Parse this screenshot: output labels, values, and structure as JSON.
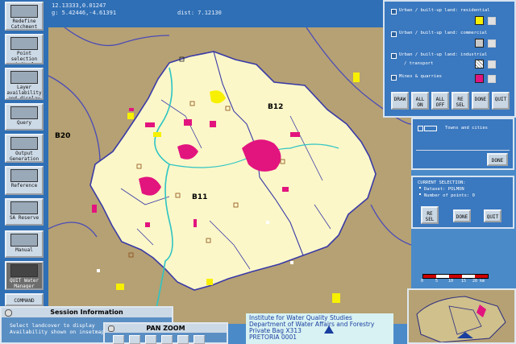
{
  "coordinates": {
    "line1": "12.13333,0.01247",
    "line2": "g: 5.42446,-4.61391",
    "distance": "dist: 7.12130"
  },
  "toolbar": {
    "items": [
      {
        "label": "Redefine Catchment"
      },
      {
        "label": "Point selection and display"
      },
      {
        "label": "Layer availability and display"
      },
      {
        "label": "Query"
      },
      {
        "label": "Output Generation"
      },
      {
        "label": "Reference"
      },
      {
        "label": "SA Reserve"
      },
      {
        "label": "Manual"
      },
      {
        "label": "QUIT Water Manager"
      },
      {
        "label": "COMMAND"
      }
    ]
  },
  "map": {
    "regions": {
      "b12": "B12",
      "b20": "B20",
      "b11": "B11"
    }
  },
  "legend": {
    "rows": [
      {
        "label": "Urban / built-up land: residential",
        "color": "#f7f000"
      },
      {
        "label": "Urban / built-up land: commercial",
        "color": "#c8c8c8"
      },
      {
        "label": "Urban / built-up land: industrial",
        "label2": "/ transport",
        "color": "#ffffff"
      },
      {
        "label": "Mines & quarries",
        "color": "#e2147e"
      }
    ],
    "buttons": [
      "DRAW",
      "ALL ON",
      "ALL OFF",
      "RE SEL",
      "DONE",
      "QUIT"
    ]
  },
  "towns": {
    "label": "Towns and cities",
    "done": "DONE"
  },
  "selection": {
    "title": "CURRENT SELECTION:",
    "dataset": "Dataset: POLMON",
    "points": "Number of points: 0",
    "buttons": [
      "RE SEL",
      "DONE",
      "QUIT"
    ]
  },
  "scalebar": {
    "ticks": [
      "0",
      "5",
      "10",
      "15",
      "20 km"
    ]
  },
  "session": {
    "title": "Session Information",
    "line1": "Select landcover to display",
    "line2": "Availability shown on insetmap"
  },
  "panzoom": {
    "title": "PAN ZOOM"
  },
  "institute": {
    "lines": [
      "Institute for Water Quality Studies",
      "Department of Water Affairs and Forestry",
      "Private Bag X313",
      "PRETORIA 0001"
    ]
  },
  "colors": {
    "map_background": "#b5a173",
    "catchment_fill": "#fbf7c8",
    "river": "#2ec4c4",
    "mines": "#e2147e",
    "residential": "#f7f000",
    "panel_blue": "#3a78bf"
  }
}
